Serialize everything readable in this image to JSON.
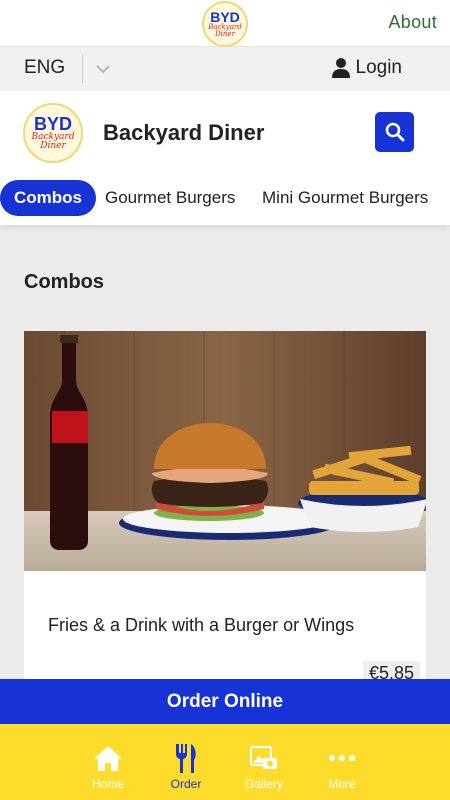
{
  "top_bar": {
    "logo": {
      "abbr": "BYD",
      "script_1": "Backyard",
      "script_2": "Diner"
    },
    "about": "About"
  },
  "lang_bar": {
    "language": "ENG",
    "login": "Login"
  },
  "header": {
    "logo": {
      "abbr": "BYD",
      "script_1": "Backyard",
      "script_2": "Diner"
    },
    "restaurant_name": "Backyard Diner"
  },
  "tabs": [
    {
      "label": "Combos",
      "active": true
    },
    {
      "label": "Gourmet Burgers",
      "active": false
    },
    {
      "label": "Mini Gourmet Burgers",
      "active": false
    }
  ],
  "section": {
    "title": "Combos"
  },
  "items": [
    {
      "title": "Fries & a Drink with a Burger or Wings",
      "price": "€5.85"
    }
  ],
  "order_bar": {
    "label": "Order Online"
  },
  "bottom_nav": [
    {
      "label": "Home",
      "icon": "home-icon"
    },
    {
      "label": "Order",
      "icon": "fork-knife-icon",
      "active": true
    },
    {
      "label": "Gallery",
      "icon": "gallery-icon"
    },
    {
      "label": "More",
      "icon": "more-dots-icon"
    }
  ],
  "colors": {
    "accent": "#1733d6",
    "nav_bg": "#fddc2c",
    "about": "#2f6e2f"
  }
}
